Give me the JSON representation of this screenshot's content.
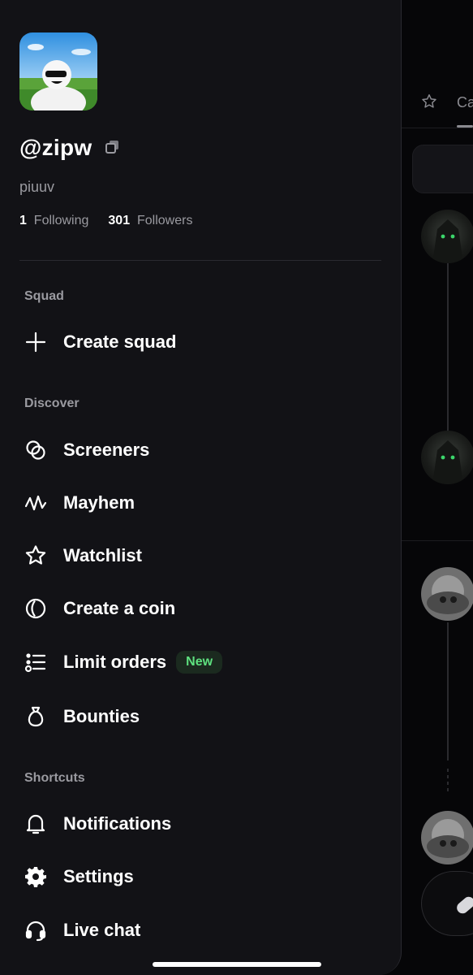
{
  "background": {
    "tab_label": "Ca"
  },
  "profile": {
    "username": "@zipw",
    "display_name": "piuuv",
    "following_count": "1",
    "following_label": "Following",
    "followers_count": "301",
    "followers_label": "Followers"
  },
  "sections": {
    "squad": {
      "title": "Squad",
      "items": [
        {
          "label": "Create squad",
          "icon": "plus-icon"
        }
      ]
    },
    "discover": {
      "title": "Discover",
      "items": [
        {
          "label": "Screeners",
          "icon": "overlapping-circles-icon"
        },
        {
          "label": "Mayhem",
          "icon": "pulse-wave-icon"
        },
        {
          "label": "Watchlist",
          "icon": "star-icon"
        },
        {
          "label": "Create a coin",
          "icon": "coin-icon"
        },
        {
          "label": "Limit orders",
          "icon": "list-icon",
          "badge": "New"
        },
        {
          "label": "Bounties",
          "icon": "money-bag-icon"
        }
      ]
    },
    "shortcuts": {
      "title": "Shortcuts",
      "items": [
        {
          "label": "Notifications",
          "icon": "bell-icon"
        },
        {
          "label": "Settings",
          "icon": "gear-icon"
        },
        {
          "label": "Live chat",
          "icon": "headset-icon"
        }
      ]
    }
  },
  "colors": {
    "drawer_bg": "#121216",
    "badge_bg": "#1b2a1f",
    "badge_text": "#5ee17f",
    "muted_text": "#9a9aa0"
  }
}
